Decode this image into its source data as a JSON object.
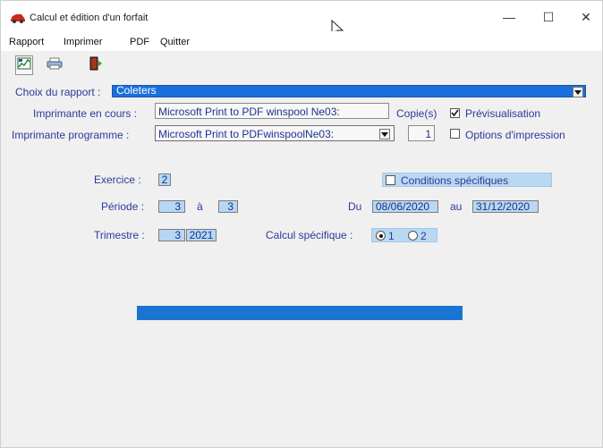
{
  "window": {
    "title": "Calcul et édition d'un forfait",
    "icons": {
      "app": "car-icon",
      "minimize": "minimize-icon",
      "maximize": "maximize-icon",
      "close": "close-icon"
    },
    "controls": {
      "minimize": "—",
      "maximize": "☐",
      "close": "✕"
    }
  },
  "menu": {
    "items": [
      "Rapport",
      "Imprimer",
      "PDF",
      "Quitter"
    ]
  },
  "toolbar": {
    "buttons": [
      {
        "icon": "chart-icon",
        "name": "report-button"
      },
      {
        "icon": "printer-icon",
        "name": "print-button"
      },
      {
        "icon": "exit-door-icon",
        "name": "quit-button"
      }
    ]
  },
  "form": {
    "choix_label": "Choix du rapport :",
    "report_value": "Coleters",
    "imprimante_en_cours_label": "Imprimante en cours :",
    "imprimante_en_cours_value": "Microsoft Print to PDF  winspool Ne03:",
    "copies_label": "Copie(s)",
    "previsualisation_label": "Prévisualisation",
    "previsualisation_checked": true,
    "imprimante_programme_label": "Imprimante programme :",
    "imprimante_programme_value": "Microsoft Print to PDFwinspoolNe03:",
    "copies_value": "1",
    "options_impression_label": "Options d'impression",
    "options_impression_checked": false,
    "exercice_label": "Exercice :",
    "exercice_value": "2",
    "conditions_label": "Conditions spécifiques",
    "conditions_checked": false,
    "periode_label": "Période :",
    "periode_from": "3",
    "periode_sep": "à",
    "periode_to": "3",
    "du_label": "Du",
    "du_value": "08/06/2020",
    "au_label": "au",
    "au_value": "31/12/2020",
    "trimestre_label": "Trimestre :",
    "trimestre_value": "3",
    "annee_value": "2021",
    "calcul_label": "Calcul spécifique :",
    "calcul_options": [
      "1",
      "2"
    ],
    "calcul_selected": "1"
  },
  "colors": {
    "accent": "#1a6fdc",
    "label_text": "#2b3a9a",
    "field_fill": "#b6d7f3",
    "progress": "#1975d1"
  },
  "progress": {
    "fraction": 1
  }
}
